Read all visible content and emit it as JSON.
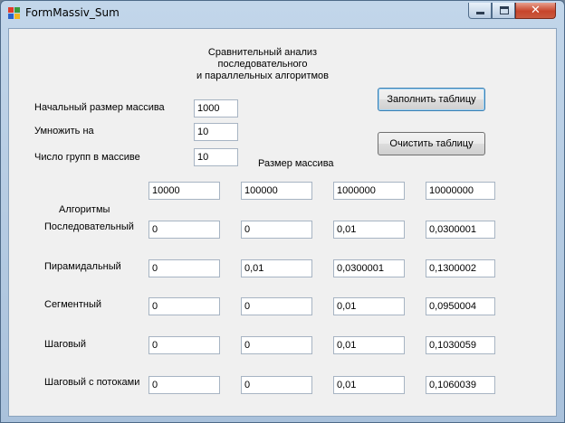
{
  "window": {
    "title": "FormMassiv_Sum"
  },
  "heading": [
    "Сравнительный анализ",
    "последовательного",
    "и параллельных алгоритмов"
  ],
  "params": [
    {
      "label": "Начальный размер массива",
      "value": "1000"
    },
    {
      "label": "Умножить на",
      "value": "10"
    },
    {
      "label": "Число групп в массиве",
      "value": "10"
    }
  ],
  "buttons": {
    "fill": "Заполнить таблицу",
    "clear": "Очистить таблицу"
  },
  "table": {
    "size_caption": "Размер массива",
    "algorithms_caption": "Алгоритмы",
    "sizes": [
      "10000",
      "100000",
      "1000000",
      "10000000"
    ],
    "rows": [
      {
        "name": "Последовательный",
        "values": [
          "0",
          "0",
          "0,01",
          "0,0300001"
        ]
      },
      {
        "name": "Пирамидальный",
        "values": [
          "0",
          "0,01",
          "0,0300001",
          "0,1300002"
        ]
      },
      {
        "name": "Сегментный",
        "values": [
          "0",
          "0",
          "0,01",
          "0,0950004"
        ]
      },
      {
        "name": "Шаговый",
        "values": [
          "0",
          "0",
          "0,01",
          "0,1030059"
        ]
      },
      {
        "name": "Шаговый с потоками",
        "values": [
          "0",
          "0",
          "0,01",
          "0,1060039"
        ]
      }
    ]
  }
}
